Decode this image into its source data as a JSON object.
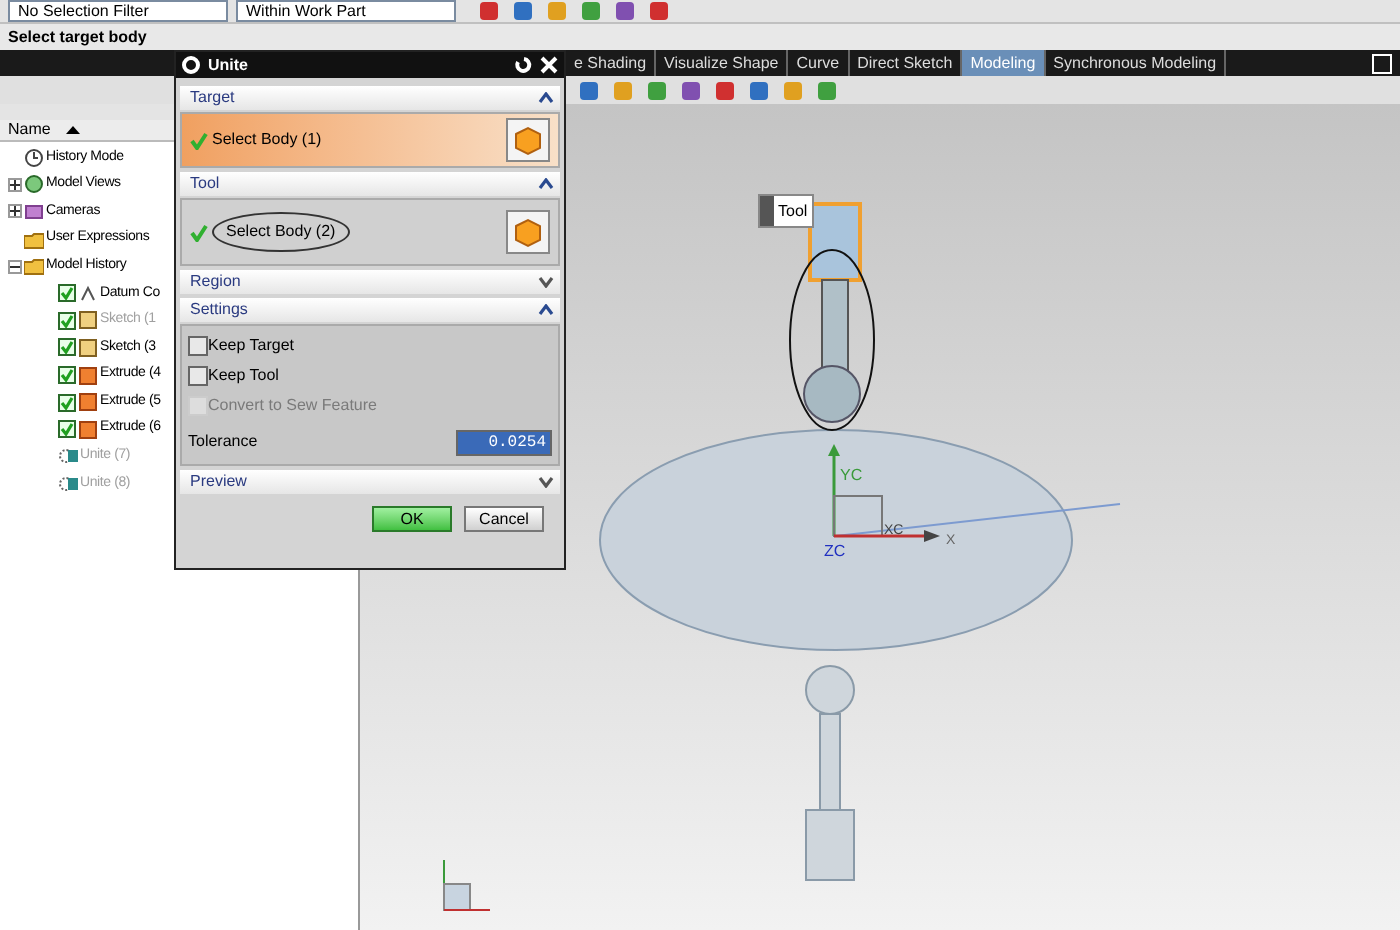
{
  "toolbar": {
    "selection_filter": "No Selection Filter",
    "scope": "Within Work Part"
  },
  "cue_line": "Select target body",
  "ribbon_tabs": [
    {
      "label": "e Shading",
      "selected": false
    },
    {
      "label": "Visualize Shape",
      "selected": false
    },
    {
      "label": "Curve",
      "selected": false
    },
    {
      "label": "Direct Sketch",
      "selected": false
    },
    {
      "label": "Modeling",
      "selected": true
    },
    {
      "label": "Synchronous Modeling",
      "selected": false
    }
  ],
  "navigator": {
    "column": "Name",
    "items": [
      {
        "label": "History Mode",
        "kind": "history"
      },
      {
        "label": "Model Views",
        "kind": "views",
        "expanded": false
      },
      {
        "label": "Cameras",
        "kind": "cameras",
        "expanded": false
      },
      {
        "label": "User Expressions",
        "kind": "folder"
      },
      {
        "label": "Model History",
        "kind": "folder",
        "expanded": true,
        "children": [
          {
            "label": "Datum Co",
            "kind": "datum",
            "checked": true,
            "disabled": false
          },
          {
            "label": "Sketch (1",
            "kind": "sketch",
            "checked": true,
            "disabled": true
          },
          {
            "label": "Sketch (3",
            "kind": "sketch",
            "checked": true,
            "disabled": false
          },
          {
            "label": "Extrude (4",
            "kind": "extrude",
            "checked": true,
            "disabled": false
          },
          {
            "label": "Extrude (5",
            "kind": "extrude",
            "checked": true,
            "disabled": false
          },
          {
            "label": "Extrude (6",
            "kind": "extrude",
            "checked": true,
            "disabled": false
          },
          {
            "label": "Unite (7)",
            "kind": "unite",
            "disabled": true
          },
          {
            "label": "Unite (8)",
            "kind": "unite",
            "disabled": true
          }
        ]
      }
    ]
  },
  "dialog": {
    "title": "Unite",
    "sections": [
      {
        "title": "Target",
        "expanded": true,
        "kind": "select",
        "value": "Select Body (1)",
        "active": true
      },
      {
        "title": "Tool",
        "expanded": true,
        "kind": "select",
        "value": "Select Body (2)",
        "active": false
      },
      {
        "title": "Region",
        "expanded": false
      },
      {
        "title": "Settings",
        "expanded": true,
        "kind": "settings",
        "options": [
          {
            "label": "Keep Target",
            "checked": false,
            "disabled": false
          },
          {
            "label": "Keep Tool",
            "checked": false,
            "disabled": false
          },
          {
            "label": "Convert to Sew Feature",
            "checked": false,
            "disabled": true
          }
        ],
        "tolerance_label": "Tolerance",
        "tolerance": "0.0254"
      },
      {
        "title": "Preview",
        "expanded": false
      }
    ],
    "buttons": [
      {
        "label": "OK",
        "default": true
      },
      {
        "label": "Cancel",
        "default": false
      }
    ]
  },
  "viewport": {
    "tool_tag": "Tool",
    "axes": [
      "YC",
      "ZC",
      "XC",
      "X"
    ]
  }
}
